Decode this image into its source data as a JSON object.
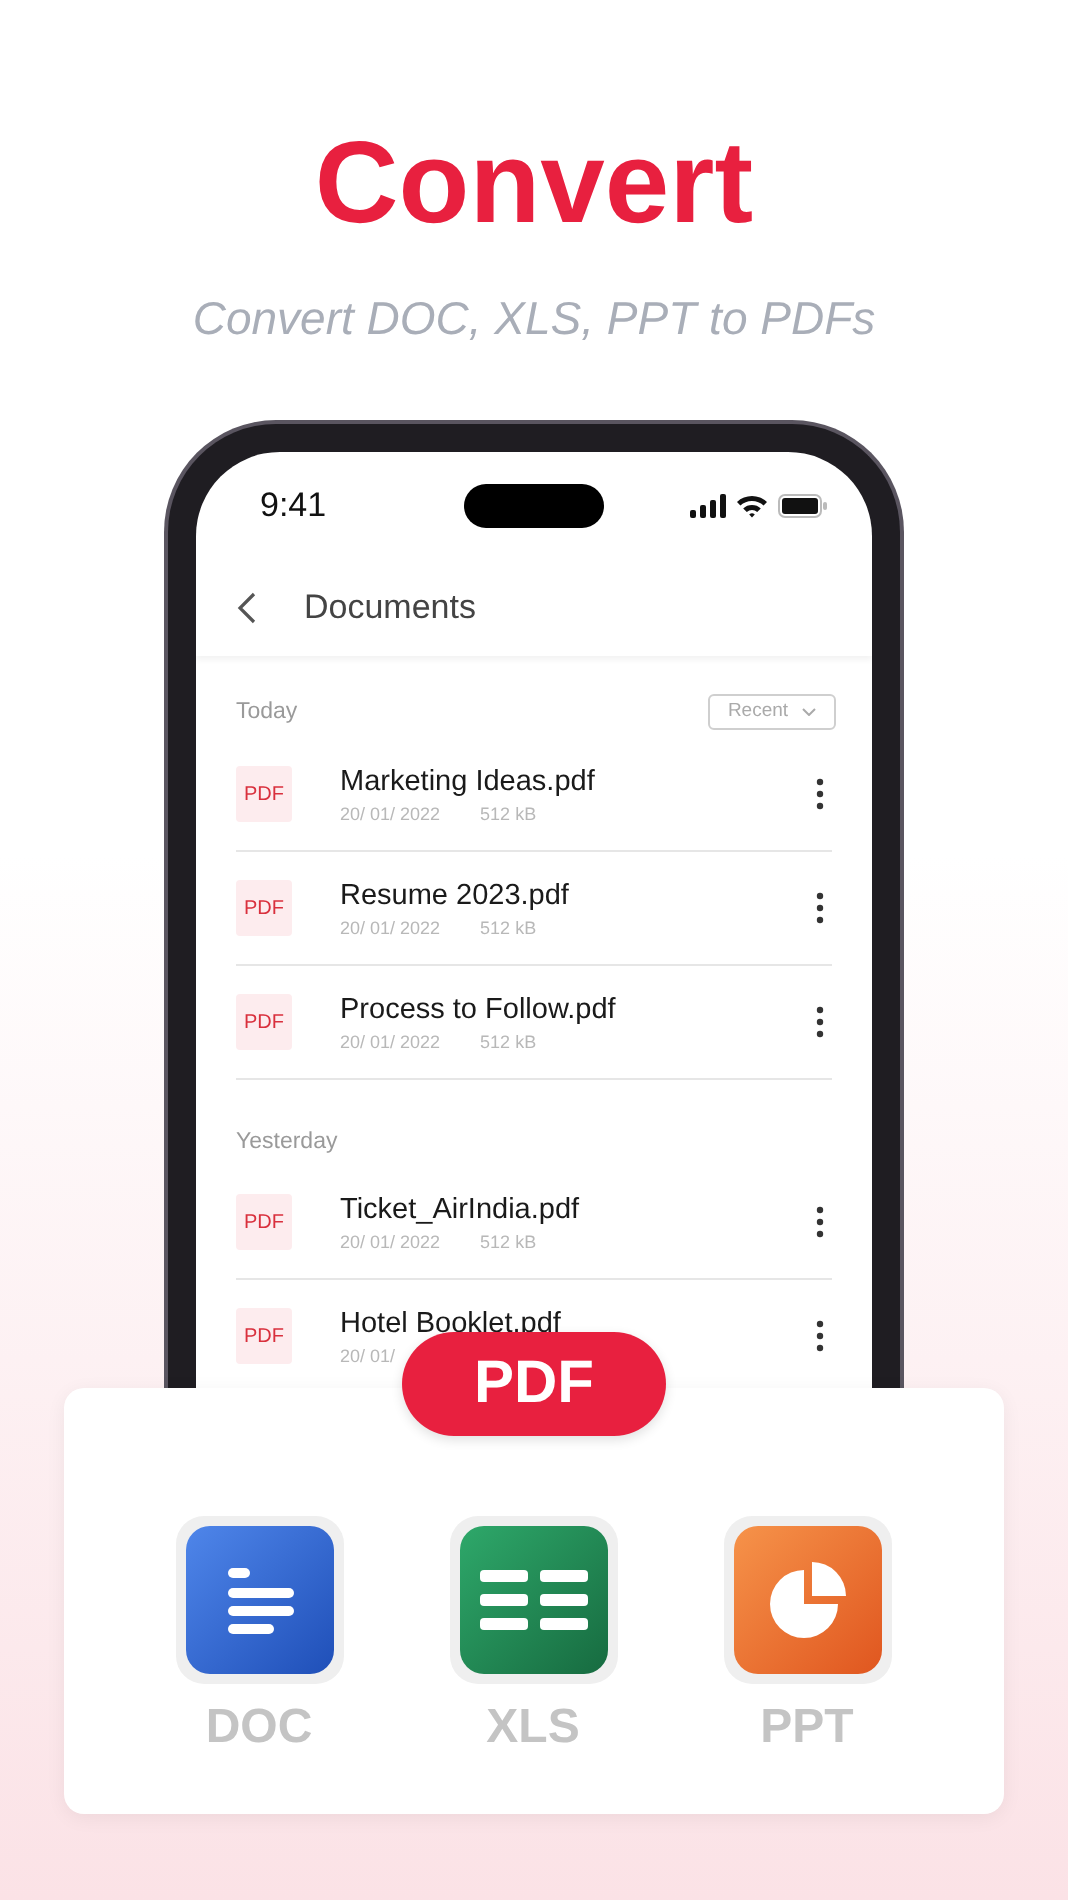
{
  "header": {
    "title": "Convert",
    "subtitle": "Convert DOC, XLS, PPT to PDFs"
  },
  "phone": {
    "time": "9:41",
    "nav_title": "Documents",
    "sections": [
      {
        "label": "Today",
        "sort": "Recent",
        "files": [
          {
            "badge": "PDF",
            "name": "Marketing Ideas.pdf",
            "date": "20/ 01/ 2022",
            "size": "512 kB"
          },
          {
            "badge": "PDF",
            "name": "Resume 2023.pdf",
            "date": "20/ 01/ 2022",
            "size": "512 kB"
          },
          {
            "badge": "PDF",
            "name": "Process to Follow.pdf",
            "date": "20/ 01/ 2022",
            "size": "512 kB"
          }
        ]
      },
      {
        "label": "Yesterday",
        "files": [
          {
            "badge": "PDF",
            "name": "Ticket_AirIndia.pdf",
            "date": "20/ 01/ 2022",
            "size": "512 kB"
          },
          {
            "badge": "PDF",
            "name": "Hotel Booklet.pdf",
            "date": "20/ 01/"
          }
        ]
      }
    ]
  },
  "converter": {
    "target": "PDF",
    "formats": [
      {
        "kind": "doc",
        "label": "DOC"
      },
      {
        "kind": "xls",
        "label": "XLS"
      },
      {
        "kind": "ppt",
        "label": "PPT"
      }
    ]
  }
}
